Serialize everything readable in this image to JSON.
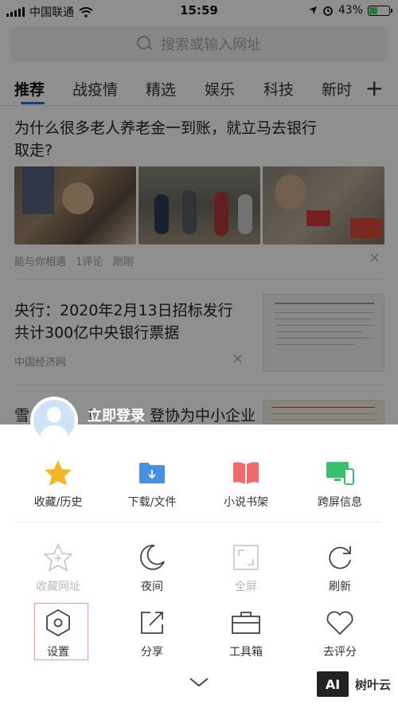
{
  "status": {
    "carrier": "中国联通",
    "time": "15:59",
    "battery": "43%",
    "battery_level": 0.43
  },
  "search": {
    "placeholder": "搜索或输入网址"
  },
  "tabs": [
    "推荐",
    "战疫情",
    "精选",
    "娱乐",
    "科技",
    "新时"
  ],
  "feed": [
    {
      "title_line1": "为什么很多老人养老金一到账，就立马去银行",
      "title_line2": "取走?",
      "source": "能与你相遇",
      "comments": "1评论",
      "time": "刚刚"
    },
    {
      "title_line1": "央行：2020年2月13日招标发行",
      "title_line2": "共计300亿中央银行票据",
      "source": "中国经济网"
    },
    {
      "title_partial": "雪",
      "title_partial2": "！",
      "title_rest": "登协为中小企业"
    }
  ],
  "sheet": {
    "login": "立即登录",
    "row1": [
      {
        "icon": "star-icon",
        "label": "收藏/历史"
      },
      {
        "icon": "download-folder-icon",
        "label": "下载/文件"
      },
      {
        "icon": "book-icon",
        "label": "小说书架"
      },
      {
        "icon": "cross-screen-icon",
        "label": "跨屏信息"
      }
    ],
    "row2": [
      {
        "icon": "add-bookmark-icon",
        "label": "收藏网址",
        "enabled": false
      },
      {
        "icon": "moon-icon",
        "label": "夜间"
      },
      {
        "icon": "fullscreen-icon",
        "label": "全屏",
        "enabled": false
      },
      {
        "icon": "refresh-icon",
        "label": "刷新"
      }
    ],
    "row3": [
      {
        "icon": "settings-icon",
        "label": "设置"
      },
      {
        "icon": "share-icon",
        "label": "分享"
      },
      {
        "icon": "toolbox-icon",
        "label": "工具箱"
      },
      {
        "icon": "heart-icon",
        "label": "去评分"
      }
    ]
  },
  "watermark": {
    "logo": "AI",
    "text": "树叶云"
  },
  "colors": {
    "accent": "#2a6df4",
    "star": "#f5b623",
    "folder": "#4a90e2",
    "book": "#f06a6a",
    "screen": "#3cbf6a"
  }
}
